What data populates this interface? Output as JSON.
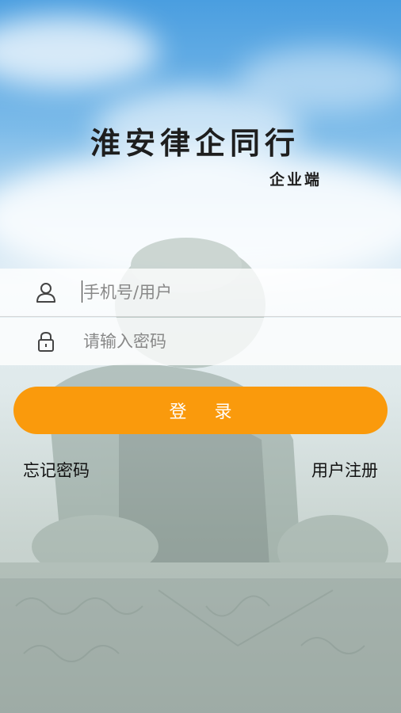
{
  "app": {
    "title": "淮安律企同行",
    "subtitle": "企业端"
  },
  "login_form": {
    "username_placeholder": "手机号/用户",
    "username_value": "",
    "password_placeholder": "请输入密码",
    "password_value": "",
    "user_icon": "user-icon",
    "lock_icon": "lock-icon"
  },
  "actions": {
    "login_label": "登 录",
    "forgot_password_label": "忘记密码",
    "register_label": "用户注册"
  },
  "colors": {
    "accent": "#fa9a0c",
    "button_text": "#ffffff"
  }
}
